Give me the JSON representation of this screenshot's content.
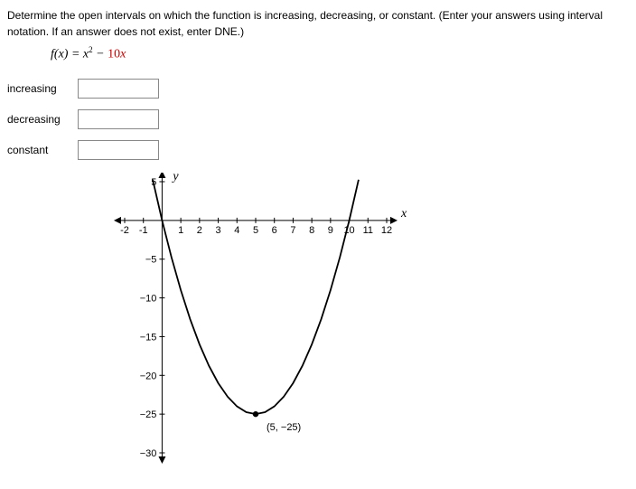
{
  "instructions": "Determine the open intervals on which the function is increasing, decreasing, or constant. (Enter your answers using interval notation. If an answer does not exist, enter DNE.)",
  "formula": {
    "lhs_f": "f",
    "lhs_x": "x",
    "eq": " = ",
    "coef1": "",
    "var1": "x",
    "exp1": "2",
    "op": " − ",
    "coef2": "10",
    "var2": "x"
  },
  "answers": {
    "increasing": {
      "label": "increasing",
      "value": ""
    },
    "decreasing": {
      "label": "decreasing",
      "value": ""
    },
    "constant": {
      "label": "constant",
      "value": ""
    }
  },
  "chart_data": {
    "type": "line",
    "title": "",
    "xlabel": "x",
    "ylabel": "y",
    "xlim": [
      -2,
      12
    ],
    "ylim": [
      -30,
      5
    ],
    "xticks": [
      -2,
      -1,
      1,
      2,
      3,
      4,
      5,
      6,
      7,
      8,
      9,
      10,
      11,
      12
    ],
    "yticks": [
      5,
      -5,
      -10,
      -15,
      -20,
      -25,
      -30
    ],
    "function": "x^2 - 10x",
    "vertex": {
      "x": 5,
      "y": -25,
      "label": "(5, −25)"
    },
    "series": [
      {
        "name": "f(x)",
        "x": [
          -0.5,
          0,
          0.5,
          1,
          1.5,
          2,
          2.5,
          3,
          3.5,
          4,
          4.5,
          5,
          5.5,
          6,
          6.5,
          7,
          7.5,
          8,
          8.5,
          9,
          9.5,
          10,
          10.5
        ],
        "y": [
          5.25,
          0,
          -4.75,
          -9,
          -12.75,
          -16,
          -18.75,
          -21,
          -22.75,
          -24,
          -24.75,
          -25,
          -24.75,
          -24,
          -22.75,
          -21,
          -18.75,
          -16,
          -12.75,
          -9,
          -4.75,
          0,
          5.25
        ]
      }
    ]
  }
}
